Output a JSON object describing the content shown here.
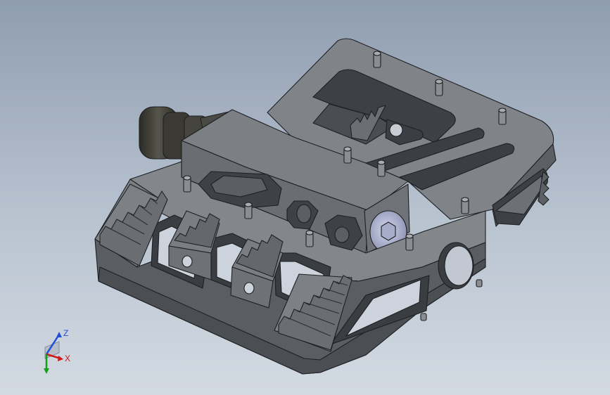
{
  "viewport": {
    "background_top": "#8f9db0",
    "background_bottom": "#d3dae2",
    "part_color": "#73777c",
    "part_edge_color": "#1e1f22",
    "axle_color": "#3a3a34",
    "socket_color": "#b9bdd8"
  },
  "triad": {
    "z_label": "Z",
    "x_label": "X",
    "z_color": "#1f4fd6",
    "x_color": "#d01818",
    "y_color": "#14a014"
  }
}
